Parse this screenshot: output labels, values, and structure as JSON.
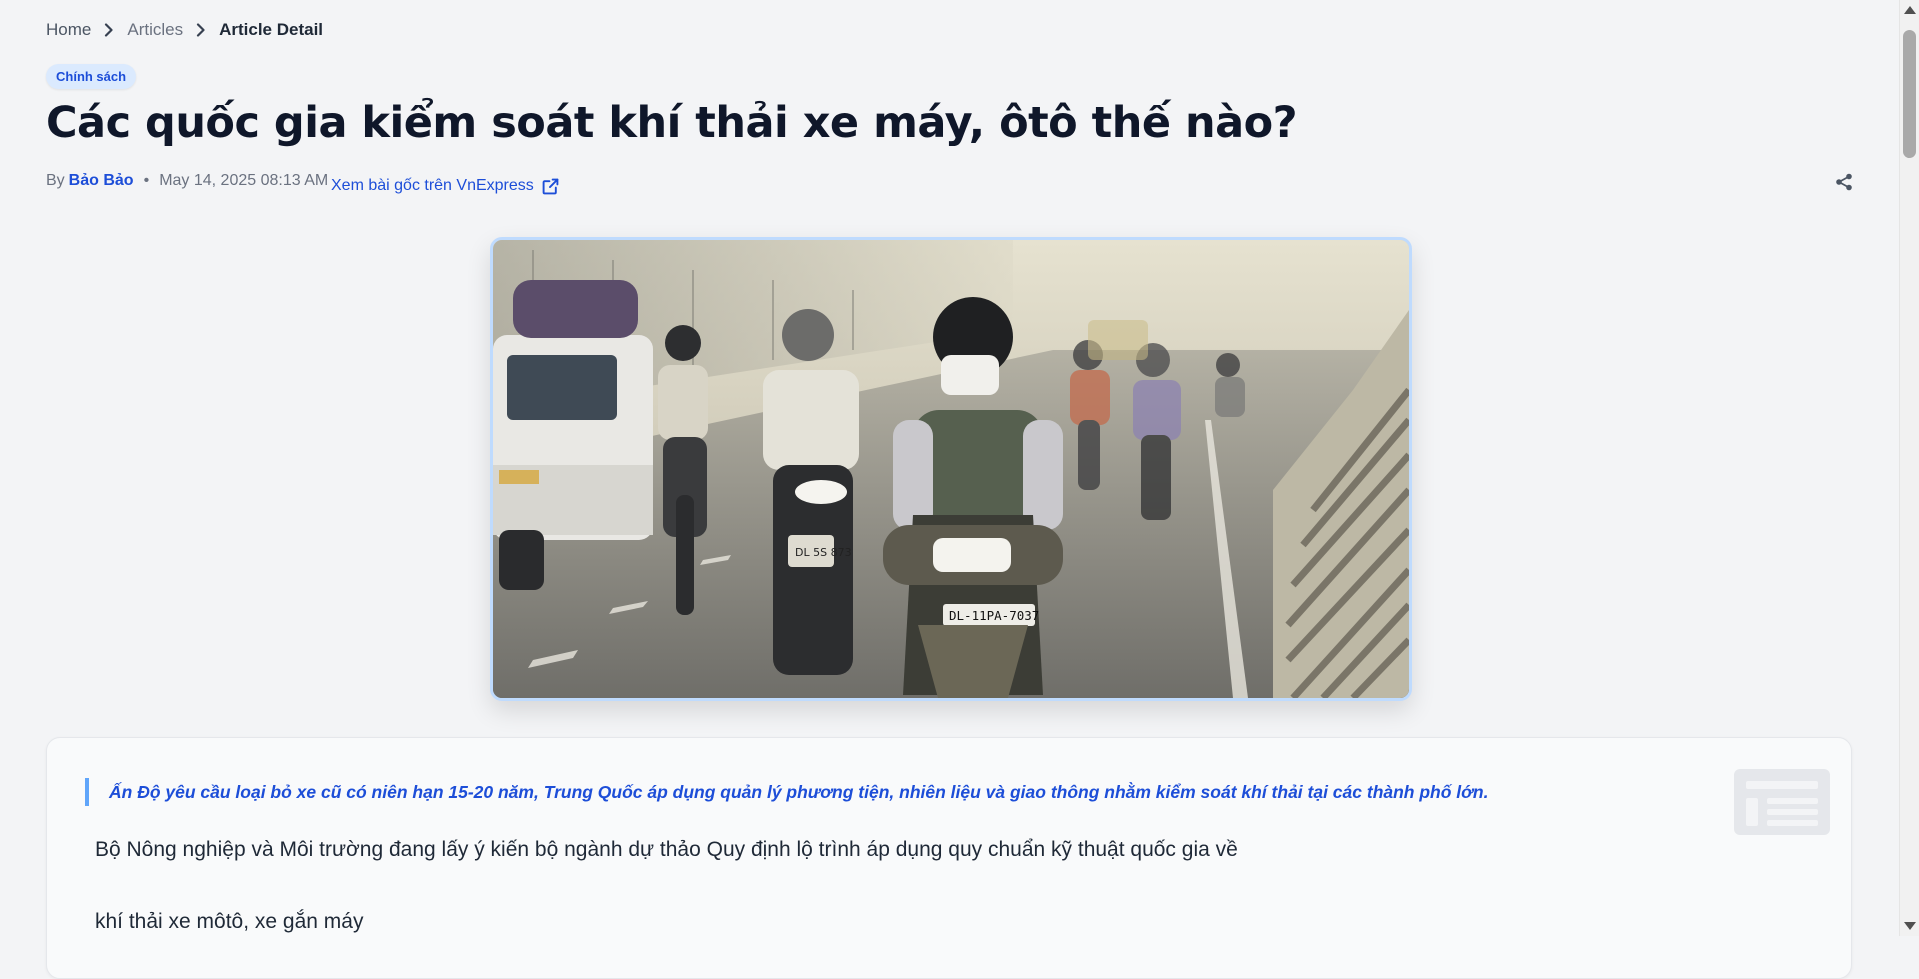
{
  "breadcrumb": {
    "home": "Home",
    "articles": "Articles",
    "current": "Article Detail"
  },
  "article": {
    "category": "Chính sách",
    "title": "Các quốc gia kiểm soát khí thải xe máy, ôtô thế nào?",
    "by_label": "By",
    "author": "Bảo Bảo",
    "separator": "•",
    "date": "May 14, 2025 08:13 AM",
    "source_link": "Xem bài gốc trên VnExpress",
    "summary": "Ấn Độ yêu cầu loại bỏ xe cũ có niên hạn 15-20 năm, Trung Quốc áp dụng quản lý phương tiện, nhiên liệu và giao thông nhằm kiểm soát khí thải tại các thành phố lớn.",
    "paragraphs": [
      "Bộ Nông nghiệp và Môi trường đang lấy ý kiến bộ ngành dự thảo Quy định lộ trình áp dụng quy chuẩn kỹ thuật quốc gia về",
      "khí thải xe môtô, xe gắn máy"
    ],
    "hero_image": {
      "plate_main": "DL-11PA-7037",
      "plate_left": "DL 5S 873"
    }
  },
  "icons": {
    "breadcrumb_separator": "chevron-right-icon",
    "external_link": "external-link-icon",
    "share": "share-icon",
    "article_placeholder": "newspaper-icon"
  },
  "colors": {
    "background": "#f3f4f6",
    "accent": "#1d4ed8",
    "badge_bg": "#dbeafe",
    "quote_border": "#60a5fa",
    "title": "#0f172a"
  }
}
